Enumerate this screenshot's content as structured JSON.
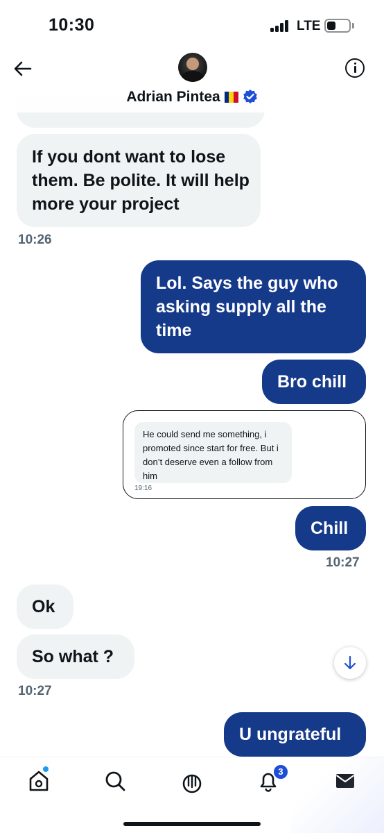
{
  "status_bar": {
    "time": "10:30",
    "network": "LTE"
  },
  "header": {
    "contact_name": "Adrian Pintea",
    "flag_colors": [
      "#002b7f",
      "#fcd116",
      "#ce1126"
    ],
    "verified": true
  },
  "messages": [
    {
      "id": "m0",
      "direction": "received",
      "text": "If you dont want to lose them. Be polite. It will help more your project",
      "time": "10:26"
    },
    {
      "id": "m1",
      "direction": "sent",
      "text": "Lol. Says the guy who asking supply all the time"
    },
    {
      "id": "m2",
      "direction": "sent",
      "text": "Bro chill"
    },
    {
      "id": "m3",
      "direction": "sent",
      "type": "image",
      "embed": {
        "text": "He could send me something, i promoted since start for free. But i don’t deserve even a follow from him",
        "time": "19:16"
      }
    },
    {
      "id": "m4",
      "direction": "sent",
      "text": "Chill",
      "time": "10:27"
    },
    {
      "id": "m5",
      "direction": "received",
      "text": "Ok"
    },
    {
      "id": "m6",
      "direction": "received",
      "text": "So what ?",
      "time": "10:27"
    },
    {
      "id": "m7",
      "direction": "sent",
      "text": "U ungrateful"
    }
  ],
  "tab_bar": {
    "items": [
      "home-icon",
      "search-icon",
      "spaces-icon",
      "notifications-icon",
      "messages-icon"
    ],
    "notification_count": "3"
  },
  "colors": {
    "sent_bubble": "#163a8a",
    "received_bubble": "#eff3f4",
    "accent": "#1d9bf0"
  }
}
